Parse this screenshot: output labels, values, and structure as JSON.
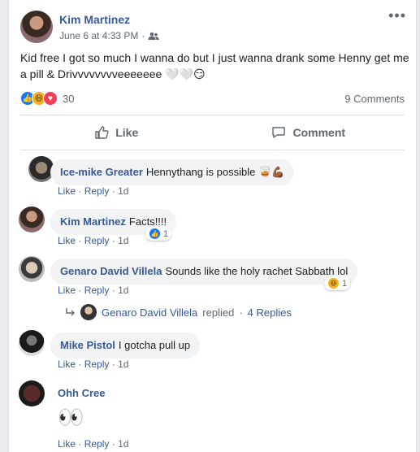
{
  "post": {
    "author": "Kim Martinez",
    "time": "June 6 at 4:33 PM",
    "separator": "·",
    "audience_icon": "friends-icon",
    "text": "Kid free I got so much I wanna do but I just wanna drank some Henny get me a pill & Drivvvvvvvveeeeeee",
    "text_emoji": "🤍🤍😏",
    "reaction_count": "30",
    "comment_count": "9 Comments",
    "like_label": "Like",
    "comment_label": "Comment"
  },
  "comments": [
    {
      "name": "Ice-mike Greater",
      "text": "Hennythang is possible",
      "emoji": "🥃💪🏾",
      "like": "Like",
      "reply": "Reply",
      "sep": "·",
      "age": "1d"
    },
    {
      "name": "Kim Martinez",
      "text": "Facts!!!!",
      "reaction_count": "1",
      "like": "Like",
      "reply": "Reply",
      "sep": "·",
      "age": "1d"
    },
    {
      "name": "Genaro David Villela",
      "text": "Sounds like the holy rachet Sabbath lol",
      "reaction_count": "1",
      "like": "Like",
      "reply": "Reply",
      "sep": "·",
      "age": "1d",
      "replies": {
        "name": "Genaro David Villela",
        "verb": "replied",
        "sep": "·",
        "count": "4 Replies"
      }
    },
    {
      "name": "Mike Pistol",
      "text": "I gotcha pull up",
      "like": "Like",
      "reply": "Reply",
      "sep": "·",
      "age": "1d"
    },
    {
      "name": "Ohh Cree",
      "text": "",
      "emoji": "👀",
      "like": "Like",
      "reply": "Reply",
      "sep": "·",
      "age": "1d"
    }
  ],
  "colors": {
    "link": "#385898",
    "muted": "#606770",
    "bubble": "#f2f3f5",
    "like_blue": "#1877f2"
  }
}
